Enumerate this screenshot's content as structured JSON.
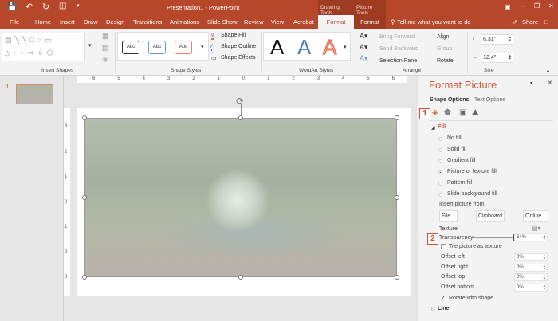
{
  "title": "Presentation1 - PowerPoint",
  "context_tabs": {
    "drawing": "Drawing Tools",
    "picture": "Picture Tools"
  },
  "tabs": [
    "File",
    "Home",
    "Insert",
    "Draw",
    "Design",
    "Transitions",
    "Animations",
    "Slide Show",
    "Review",
    "View",
    "Acrobat",
    "Format",
    "Format"
  ],
  "tell_me": "Tell me what you want to do",
  "share": "Share",
  "ribbon": {
    "groups": [
      "Insert Shapes",
      "Shape Styles",
      "WordArt Styles",
      "Arrange",
      "Size"
    ],
    "style_abc": "Abc",
    "shape_fill": "Shape Fill",
    "shape_outline": "Shape Outline",
    "shape_effects": "Shape Effects",
    "wordart_letter": "A",
    "bring_forward": "Bring Forward",
    "send_backward": "Send Backward",
    "selection_pane": "Selection Pane",
    "align": "Align",
    "group": "Group",
    "rotate": "Rotate",
    "height": "6.31\"",
    "width": "12.4\""
  },
  "ruler": [
    "6",
    "5",
    "4",
    "3",
    "2",
    "1",
    "0",
    "1",
    "2",
    "3",
    "4",
    "5",
    "6"
  ],
  "vruler": [
    "3",
    "2",
    "1",
    "0",
    "1",
    "2",
    "3"
  ],
  "slide_number": "1",
  "pane": {
    "title": "Format Picture",
    "tab_shape": "Shape Options",
    "tab_text": "Text Options",
    "marker1": "1",
    "marker2": "2",
    "fill_header": "Fill",
    "fill_options": [
      "No fill",
      "Solid fill",
      "Gradient fill",
      "Picture or texture fill",
      "Pattern fill",
      "Slide background fill"
    ],
    "selected_fill": "Picture or texture fill",
    "insert_from": "Insert picture from",
    "btn_file": "File...",
    "btn_clipboard": "Clipboard",
    "btn_online": "Online...",
    "texture": "Texture",
    "transparency": "Transparency",
    "transparency_value": "64%",
    "transparency_fraction": 0.64,
    "tile": "Tile picture as texture",
    "offsets": [
      {
        "label": "Offset left",
        "value": "0%"
      },
      {
        "label": "Offset right",
        "value": "0%"
      },
      {
        "label": "Offset top",
        "value": "0%"
      },
      {
        "label": "Offset bottom",
        "value": "0%"
      }
    ],
    "rotate_with_shape": "Rotate with shape",
    "line_header": "Line"
  }
}
